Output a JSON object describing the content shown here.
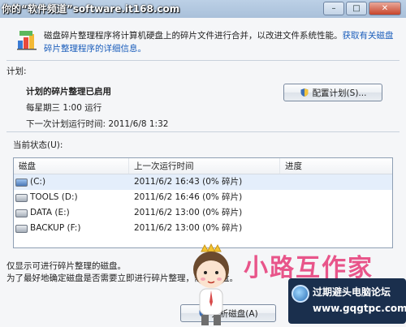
{
  "watermark_top": "你的“软件频道”software.it168.com",
  "window_controls": {
    "minimize": "–",
    "maximize": "□",
    "close": "✕"
  },
  "header": {
    "description": "磁盘碎片整理程序将计算机硬盘上的碎片文件进行合并，以改进文件系统性能。",
    "link": "获取有关磁盘碎片整理程序的详细信息。"
  },
  "schedule": {
    "section_label": "计划:",
    "status": "计划的碎片整理已启用",
    "frequency": "每星期三 1:00 运行",
    "next_run": "下一次计划运行时间: 2011/6/8 1:32",
    "configure_button": "配置计划(S)..."
  },
  "current_status": {
    "label": "当前状态(U):",
    "columns": [
      "磁盘",
      "上一次运行时间",
      "进度"
    ],
    "rows": [
      {
        "disk": "(C:)",
        "last_run": "2011/6/2 16:43 (0% 碎片)",
        "progress": "",
        "system": true
      },
      {
        "disk": "TOOLS (D:)",
        "last_run": "2011/6/2 16:46 (0% 碎片)",
        "progress": "",
        "system": false
      },
      {
        "disk": "DATA (E:)",
        "last_run": "2011/6/2 13:00 (0% 碎片)",
        "progress": "",
        "system": false
      },
      {
        "disk": "BACKUP (F:)",
        "last_run": "2011/6/2 13:00 (0% 碎片)",
        "progress": "",
        "system": false
      }
    ]
  },
  "notes": {
    "line1": "仅显示可进行碎片整理的磁盘。",
    "line2": "为了最好地确定磁盘是否需要立即进行碎片整理，需",
    "line2_end": "盘。"
  },
  "analyze_button": "分析磁盘(A)",
  "overlay": {
    "brand": "小路互作家",
    "forum_title": "过期避头电脑论坛",
    "forum_url": "www.gqgtpc.com"
  }
}
